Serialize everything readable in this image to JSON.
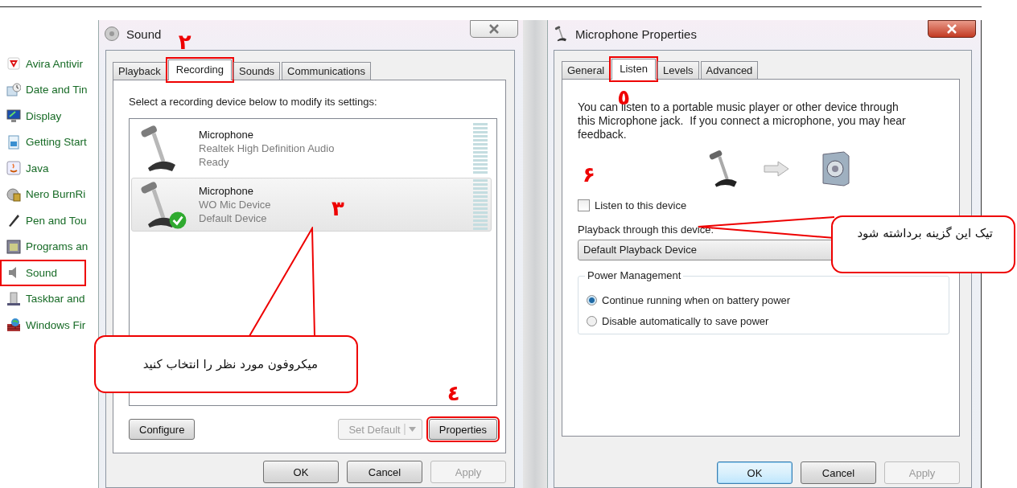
{
  "control_panel": {
    "items": [
      {
        "label": "Avira Antivir",
        "highlighted": false
      },
      {
        "label": "Date and Tin",
        "highlighted": false
      },
      {
        "label": "Display",
        "highlighted": false
      },
      {
        "label": "Getting Start",
        "highlighted": false
      },
      {
        "label": "Java",
        "highlighted": false
      },
      {
        "label": "Nero BurnRi",
        "highlighted": false
      },
      {
        "label": "Pen and Tou",
        "highlighted": false
      },
      {
        "label": "Programs an",
        "highlighted": false
      },
      {
        "label": "Sound",
        "highlighted": true
      },
      {
        "label": "Taskbar and",
        "highlighted": false
      },
      {
        "label": "Windows Fir",
        "highlighted": false
      }
    ]
  },
  "sound_dialog": {
    "title": "Sound",
    "tabs": [
      {
        "label": "Playback",
        "selected": false,
        "highlighted": false
      },
      {
        "label": "Recording",
        "selected": true,
        "highlighted": true,
        "step": "۲"
      },
      {
        "label": "Sounds",
        "selected": false,
        "highlighted": false
      },
      {
        "label": "Communications",
        "selected": false,
        "highlighted": false
      }
    ],
    "instruction": "Select a recording device below to modify its settings:",
    "devices": [
      {
        "name": "Microphone",
        "driver": "Realtek High Definition Audio",
        "status": "Ready",
        "selected": false,
        "default": false,
        "level": 0
      },
      {
        "name": "Microphone",
        "driver": "WO Mic Device",
        "status": "Default Device",
        "selected": true,
        "default": true,
        "level": 0,
        "step": "۳"
      }
    ],
    "buttons": [
      {
        "label": "Configure",
        "kind": "button",
        "disabled": false,
        "highlighted": false
      },
      {
        "label": "Set Default",
        "kind": "split",
        "disabled": true,
        "highlighted": false
      },
      {
        "label": "Properties",
        "kind": "button",
        "disabled": false,
        "highlighted": true,
        "step": "٤"
      }
    ],
    "footer_buttons": [
      {
        "label": "OK",
        "disabled": false,
        "default": false
      },
      {
        "label": "Cancel",
        "disabled": false,
        "default": false
      },
      {
        "label": "Apply",
        "disabled": true,
        "default": false
      }
    ]
  },
  "properties_dialog": {
    "title": "Microphone Properties",
    "tabs": [
      {
        "label": "General",
        "selected": false,
        "highlighted": false
      },
      {
        "label": "Listen",
        "selected": true,
        "highlighted": true,
        "step": "٥"
      },
      {
        "label": "Levels",
        "selected": false,
        "highlighted": false
      },
      {
        "label": "Advanced",
        "selected": false,
        "highlighted": false
      }
    ],
    "description": "You can listen to a portable music player or other device through this Microphone jack.  If you connect a microphone, you may hear feedback.",
    "listen_checkbox": {
      "label": "Listen to this device",
      "checked": false,
      "step": "۶"
    },
    "playback_label": "Playback through this device:",
    "playback_select": {
      "value": "Default Playback Device"
    },
    "power_management": {
      "title": "Power Management",
      "options": [
        {
          "label": "Continue running when on battery power",
          "selected": true
        },
        {
          "label": "Disable automatically to save power",
          "selected": false
        }
      ]
    },
    "footer_buttons": [
      {
        "label": "OK",
        "disabled": false,
        "default": true
      },
      {
        "label": "Cancel",
        "disabled": false,
        "default": false
      },
      {
        "label": "Apply",
        "disabled": true,
        "default": false
      }
    ]
  },
  "callouts": [
    {
      "text": "میکروفون مورد نظر را انتخاب کنید"
    },
    {
      "text": "تیک این گزینه برداشته شود"
    }
  ]
}
